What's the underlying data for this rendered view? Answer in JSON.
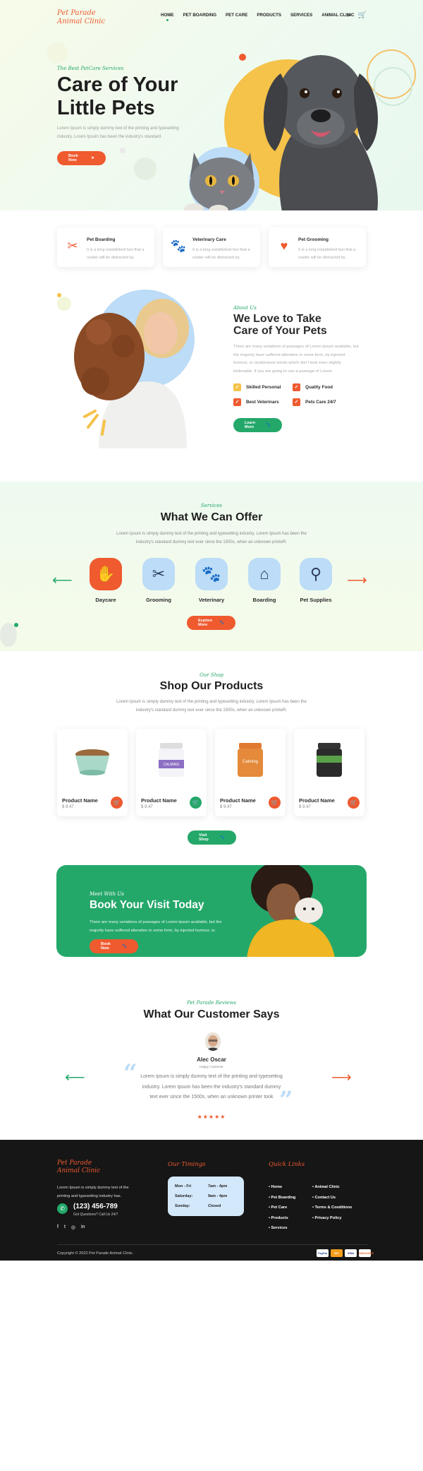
{
  "brand": {
    "logo_line1": "Pet Parade",
    "logo_line2": "Animal Clinic"
  },
  "nav": {
    "items": [
      {
        "label": "HOME",
        "active": true
      },
      {
        "label": "PET BOARDING",
        "active": false
      },
      {
        "label": "PET CARE",
        "active": false
      },
      {
        "label": "PRODUCTS",
        "active": false
      },
      {
        "label": "SERVICES",
        "active": false
      },
      {
        "label": "ANIMAL CLINIC",
        "active": false
      }
    ],
    "icons": [
      "search-icon",
      "cart-icon"
    ]
  },
  "hero": {
    "subtitle": "The Best PetCare Services",
    "title_line1": "Care of Your",
    "title_line2": "Little Pets",
    "text": "Lorem Ipsum is simply dummy text of the printing and typesetting industry. Lorem Ipsum has been the industry's standard.",
    "button": "Book Now"
  },
  "service_cards": [
    {
      "title": "Pet Boarding",
      "text": "It is a long established fact that a reader will be distracted by.",
      "icon": "comb-scissors-icon"
    },
    {
      "title": "Veterinary Care",
      "text": "It is a long established fact that a reader will be distracted by.",
      "icon": "paw-icon"
    },
    {
      "title": "Pet Grooming",
      "text": "It is a long established fact that a reader will be distracted by.",
      "icon": "hands-heart-icon"
    }
  ],
  "about": {
    "subtitle": "About Us",
    "title_line1": "We Love to Take",
    "title_line2": "Care of Your Pets",
    "text": "There are many variations of passages of Lorem Ipsum available, but the majority have suffered alteration in some form, by injected humour, or randomised words which don't look even slightly believable. If you are going to use a passage of Lorem.",
    "checks": [
      "Skilled Personal",
      "Quality Food",
      "Best Veterinars",
      "Pets Care 24/7"
    ],
    "button": "Learn More"
  },
  "offer": {
    "subtitle": "Services",
    "title": "What We Can Offer",
    "text_line1": "Lorem Ipsum is simply dummy text of the printing and typesetting industry. Lorem Ipsum has been the",
    "text_line2": "industry's standard dummy text ever since the 1500s, when an unknown printeR.",
    "items": [
      {
        "label": "Daycare",
        "icon": "daycare-icon",
        "selected": true
      },
      {
        "label": "Grooming",
        "icon": "grooming-icon",
        "selected": false
      },
      {
        "label": "Veterinary",
        "icon": "paw-icon",
        "selected": false
      },
      {
        "label": "Boarding",
        "icon": "boarding-icon",
        "selected": false
      },
      {
        "label": "Pet Supplies",
        "icon": "leash-icon",
        "selected": false
      }
    ],
    "button": "Explore More"
  },
  "shop": {
    "subtitle": "Our Shop",
    "title": "Shop Our Products",
    "text_line1": "Lorem Ipsum is simply dummy text of the printing and typesetting industry. Lorem Ipsum has been the",
    "text_line2": "industry's standard dummy text ever since the 1500s, when an unknown printeR.",
    "products": [
      {
        "name": "Product Name",
        "price": "$ 9.47",
        "cart_color": "#ef5a2f"
      },
      {
        "name": "Product Name",
        "price": "$ 9.47",
        "cart_color": "#24a86a"
      },
      {
        "name": "Product Name",
        "price": "$ 9.47",
        "cart_color": "#ef5a2f"
      },
      {
        "name": "Product Name",
        "price": "$ 9.47",
        "cart_color": "#ef5a2f"
      }
    ],
    "product_labels": {
      "p2": "CALMING",
      "p3": "Calming"
    },
    "button": "Visit Shop"
  },
  "visit": {
    "subtitle": "Meet With Us",
    "title": "Book Your Visit Today",
    "text": "There are many variations of passages of Lorem Ipsum available, but the majority have suffered alteration in some form, by injected humour, or.",
    "button": "Book Now"
  },
  "reviews": {
    "subtitle": "Pet Parade Reviews",
    "title": "What Our Customer Says",
    "name": "Alec Oscar",
    "role": "Happy Customer",
    "quote_line1": "Lorem Ipsum is simply dummy text of the printing and typesetting",
    "quote_line2": "industry. Lorem Ipsum has been the industry's standard dummy",
    "quote_line3": "text ever since the 1500s, when an unknown printer took",
    "stars": "★★★★★"
  },
  "footer": {
    "logo_line1": "Pet Parade",
    "logo_line2": "Animal Clinic",
    "desc": "Lorem Ipsum is simply dummy text of the printing and typesetting industry has.",
    "phone": "(123) 456-789",
    "phone_note": "Got Questions? Call Us 24/7",
    "timings_title": "Our Timings",
    "timings": [
      {
        "day": "Mon - Fri",
        "hours": "7am - 4pm"
      },
      {
        "day": "Saturday:",
        "hours": "9am - 4pm"
      },
      {
        "day": "Sunday:",
        "hours": "Closed"
      }
    ],
    "links_title": "Quick Links",
    "links_col1": [
      "Home",
      "Pet Boarding",
      "Pet Care",
      "Products",
      "Services"
    ],
    "links_col2": [
      "Animal Clinic",
      "Contact Us",
      "Terms & Conditions",
      "Privacy Policy"
    ],
    "copyright": "Copyright © 2022 Pet Parade Animal Clinic.",
    "payments": [
      "PayPal",
      "MC",
      "VISA",
      "DISCOVER"
    ]
  },
  "colors": {
    "accent_orange": "#ef5a2f",
    "accent_green": "#24a86a",
    "soft_blue": "#bcdcf7",
    "yellow": "#f5c24a"
  }
}
